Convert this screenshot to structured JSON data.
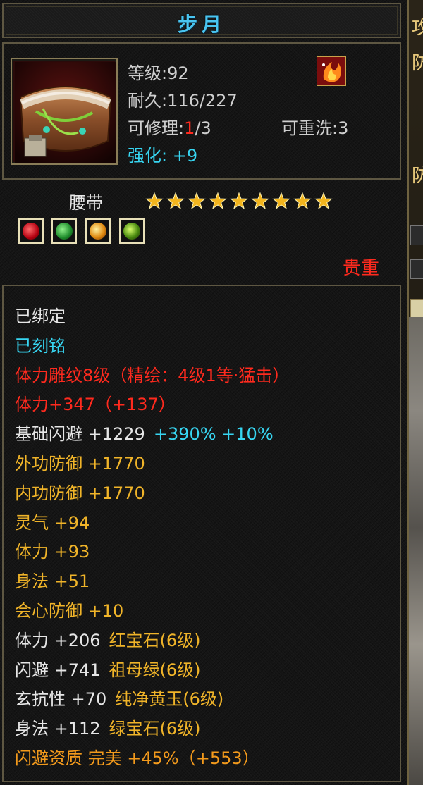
{
  "title": "步月",
  "header": {
    "level": "等级:92",
    "durability": "耐久:116/227",
    "repairable_label": "可修理:",
    "repairable_used": "1",
    "repairable_total": "/3",
    "rewash": "可重洗:3",
    "enhance_label": "强化:",
    "enhance_value": "+9"
  },
  "item_type": "腰带",
  "stars": {
    "filled": 8,
    "total": 9
  },
  "gems": [
    "red-gem-icon",
    "green-gem-icon",
    "orange-gem-icon",
    "lime-gem-icon"
  ],
  "valuable_label": "贵重",
  "side_panel_chars": [
    "攻",
    "防",
    "防"
  ],
  "lines": [
    {
      "text": "已绑定",
      "color": "white"
    },
    {
      "text": "已刻铭",
      "color": "cyan"
    },
    {
      "text": "体力雕纹8级（精绘：4级1等·猛击）",
      "color": "red"
    },
    {
      "text": "体力+347（+137）",
      "color": "red"
    },
    {
      "text": "基础闪避  +1229",
      "color": "white",
      "extra": "+390% +10%"
    },
    {
      "text": "外功防御  +1770",
      "color": "gold"
    },
    {
      "text": "内功防御  +1770",
      "color": "gold"
    },
    {
      "text": "灵气  +94",
      "color": "gold"
    },
    {
      "text": "体力  +93",
      "color": "gold"
    },
    {
      "text": "身法  +51",
      "color": "gold"
    },
    {
      "text": "会心防御  +10",
      "color": "gold"
    },
    {
      "text": "体力  +206",
      "color": "white",
      "extra": "红宝石(6级)"
    },
    {
      "text": "闪避  +741",
      "color": "white",
      "extra": "祖母绿(6级)"
    },
    {
      "text": "玄抗性  +70",
      "color": "white",
      "extra": "纯净黄玉(6级)"
    },
    {
      "text": "身法  +112",
      "color": "white",
      "extra": "绿宝石(6级)"
    },
    {
      "text": "闪避资质  完美  +45%（+553）",
      "color": "orange"
    }
  ]
}
